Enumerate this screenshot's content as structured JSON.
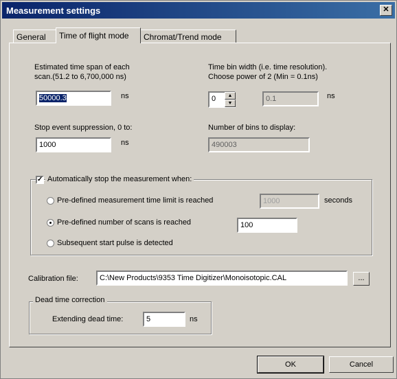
{
  "title": "Measurement settings",
  "close_glyph": "✕",
  "tabs": [
    {
      "label": "General",
      "active": false
    },
    {
      "label": "Time of flight mode",
      "active": true
    },
    {
      "label": "Chromat/Trend mode",
      "active": false
    }
  ],
  "time_span": {
    "label_line1": "Estimated time span of each",
    "label_line2": "scan.(51.2 to 6,700,000 ns)",
    "value": "50000.3",
    "unit": "ns"
  },
  "bin_width": {
    "label_line1": "Time bin width (i.e. time resolution).",
    "label_line2": "Choose power of 2  (Min = 0.1ns)",
    "value": "0",
    "result": "0.1",
    "unit": "ns"
  },
  "stop_event": {
    "label": "Stop event suppression, 0 to:",
    "value": "1000",
    "unit": "ns"
  },
  "bins_display": {
    "label": "Number of bins to display:",
    "value": "490003"
  },
  "auto_stop": {
    "label": "Automatically stop the measurement when:",
    "checked": true,
    "options": [
      {
        "label": "Pre-defined measurement time limit is reached",
        "selected": false,
        "value": "1000",
        "unit": "seconds"
      },
      {
        "label": "Pre-defined number of scans is reached",
        "selected": true,
        "value": "100"
      },
      {
        "label": "Subsequent start pulse is detected",
        "selected": false
      }
    ]
  },
  "calibration": {
    "label": "Calibration file:",
    "value": "C:\\New Products\\9353 Time Digitizer\\Monoisotopic.CAL",
    "browse_label": "..."
  },
  "dead_time": {
    "group_label": "Dead time correction",
    "label": "Extending dead time:",
    "value": "5",
    "unit": "ns"
  },
  "buttons": {
    "ok": "OK",
    "cancel": "Cancel"
  }
}
